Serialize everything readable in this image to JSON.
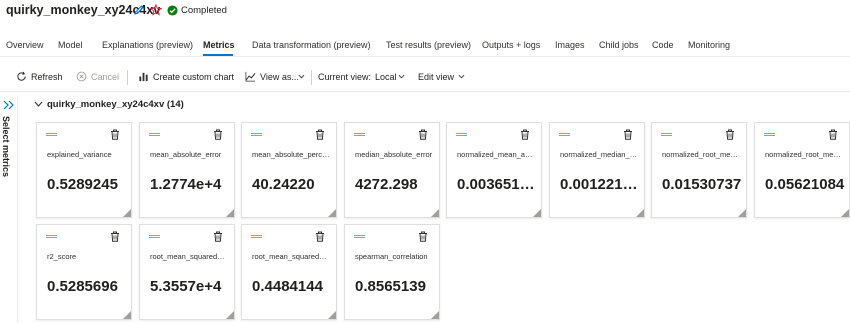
{
  "run": {
    "title": "quirky_monkey_xy24c4xv",
    "status": "Completed",
    "status_color": "#107c10"
  },
  "tabs": [
    {
      "label": "Overview"
    },
    {
      "label": "Model"
    },
    {
      "label": "Explanations (preview)"
    },
    {
      "label": "Metrics",
      "active": true
    },
    {
      "label": "Data transformation (preview)"
    },
    {
      "label": "Test results (preview)"
    },
    {
      "label": "Outputs + logs"
    },
    {
      "label": "Images"
    },
    {
      "label": "Child jobs"
    },
    {
      "label": "Code"
    },
    {
      "label": "Monitoring"
    }
  ],
  "toolbar": {
    "refresh": "Refresh",
    "cancel": "Cancel",
    "create_chart": "Create custom chart",
    "view_as": "View as...",
    "current_view_label": "Current view:",
    "current_view_value": "Local",
    "edit_view": "Edit view"
  },
  "sidebar": {
    "label": "Select metrics"
  },
  "section": {
    "title": "quirky_monkey_xy24c4xv (14)"
  },
  "metrics": [
    {
      "name": "explained_variance",
      "value": "0.5289245"
    },
    {
      "name": "mean_absolute_error",
      "value": "1.2774e+4"
    },
    {
      "name": "mean_absolute_perce...",
      "value": "40.24220"
    },
    {
      "name": "median_absolute_error",
      "value": "4272.298"
    },
    {
      "name": "normalized_mean_abs...",
      "value": "0.0036510..."
    },
    {
      "name": "normalized_median_a...",
      "value": "0.0012210..."
    },
    {
      "name": "normalized_root_mea...",
      "value": "0.01530737"
    },
    {
      "name": "normalized_root_mea...",
      "value": "0.05621084"
    },
    {
      "name": "r2_score",
      "value": "0.5285696"
    },
    {
      "name": "root_mean_squared_er...",
      "value": "5.3557e+4"
    },
    {
      "name": "root_mean_squared_lo...",
      "value": "0.4484144"
    },
    {
      "name": "spearman_correlation",
      "value": "0.8565139"
    }
  ],
  "colors": {
    "accent": "#0078d4",
    "drag_handle": "#6ea8e0"
  }
}
